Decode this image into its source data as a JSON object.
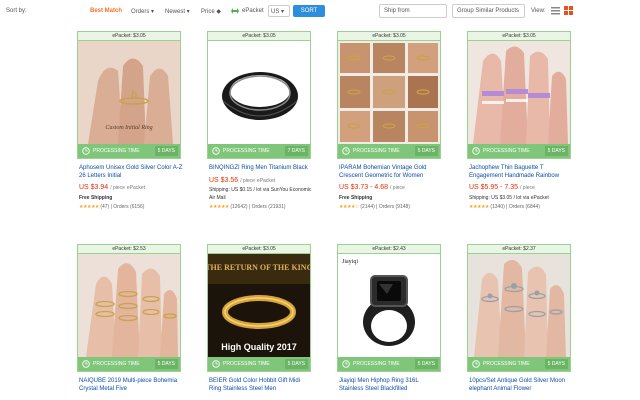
{
  "sort_bar": {
    "sort_by_label": "Sort by:",
    "best_match": "Best Match",
    "orders": "Orders ▾",
    "newest": "Newest ▾",
    "price": "Price ◆",
    "epacket": "ePacket",
    "country": "US ▾",
    "sort_button": "SORT",
    "ship_from": "Ship from",
    "group_similar": "Group Similar Products",
    "view_label": "View:",
    "accent_color": "#f57224",
    "button_color": "#2e8ede"
  },
  "colors": {
    "card_border": "#9bd28f",
    "processing_bar": "#7fc67a",
    "price": "#e62e04",
    "title_link": "#0d4ea5"
  },
  "processing_label": "PROCESSING TIME",
  "products": [
    {
      "epacket_price": "ePacket: $3.05",
      "days": "5 DAYS",
      "title": "Aphosem Unisex Gold Silver Color A-Z 26 Letters Initial",
      "price": "US $3.94",
      "unit": "/ piece",
      "shipping_method": "ePacket",
      "shipping": "Free Shipping",
      "reviews": "(47)",
      "orders": "Orders (6156)"
    },
    {
      "epacket_price": "ePacket: $3.05",
      "days": "7 DAYS",
      "title": "BINQINGZI Ring Men Titanium Black",
      "price": "US $3.56",
      "unit": "/ piece",
      "shipping_method": "ePacket",
      "shipping": "Shipping: US $0.15 / lot via SunYou Economic Air Mail",
      "reviews": "(12642)",
      "orders": "Orders (21931)"
    },
    {
      "epacket_price": "ePacket: $3.05",
      "days": "5 DAYS",
      "title": "IPARAM Bohemian Vintage Gold Crescent Geometric for Women",
      "price": "US $3.73 - 4.68",
      "unit": "/ piece",
      "shipping_method": "",
      "shipping": "Free Shipping",
      "reviews": "(2144)",
      "orders": "Orders (9148)"
    },
    {
      "epacket_price": "ePacket: $3.05",
      "days": "5 DAYS",
      "title": "Jachophew Thin Baguette T Engagement Handmade Rainbow",
      "price": "US $5.95 - 7.35",
      "unit": "/ piece",
      "shipping_method": "",
      "shipping": "Shipping: US $3.05 / lot via ePacket",
      "reviews": "(1340)",
      "orders": "Orders (6844)"
    },
    {
      "epacket_price": "ePacket: $2.53",
      "days": "5 DAYS",
      "title": "NAIQUBE 2019 Multi-piece Bohemia Crystal Metal Five",
      "price": "",
      "unit": "",
      "shipping_method": "",
      "shipping": "",
      "reviews": "",
      "orders": ""
    },
    {
      "epacket_price": "ePacket: $3.05",
      "days": "5 DAYS",
      "title": "BEIER Gold Color Hobbit Gift Midi Ring Stainless Steel Men",
      "price": "",
      "unit": "",
      "shipping_method": "",
      "shipping": "",
      "reviews": "",
      "orders": "",
      "image_text_top": "THE RETURN OF THE KING",
      "image_text_bottom": "High Quality 2017"
    },
    {
      "epacket_price": "ePacket: $2.43",
      "days": "5 DAYS",
      "title": "Jiayiqi Men Hiphop Ring 316L Stainless Steel Blackfilled",
      "price": "",
      "unit": "",
      "shipping_method": "",
      "shipping": "",
      "reviews": "",
      "orders": "",
      "image_logo": "Jiayiqi"
    },
    {
      "epacket_price": "ePacket: $2.37",
      "days": "5 DAYS",
      "title": "10pcs/Set Antique Gold Silver Moon elephant Animal Flower",
      "price": "",
      "unit": "",
      "shipping_method": "",
      "shipping": "",
      "reviews": "",
      "orders": ""
    }
  ]
}
